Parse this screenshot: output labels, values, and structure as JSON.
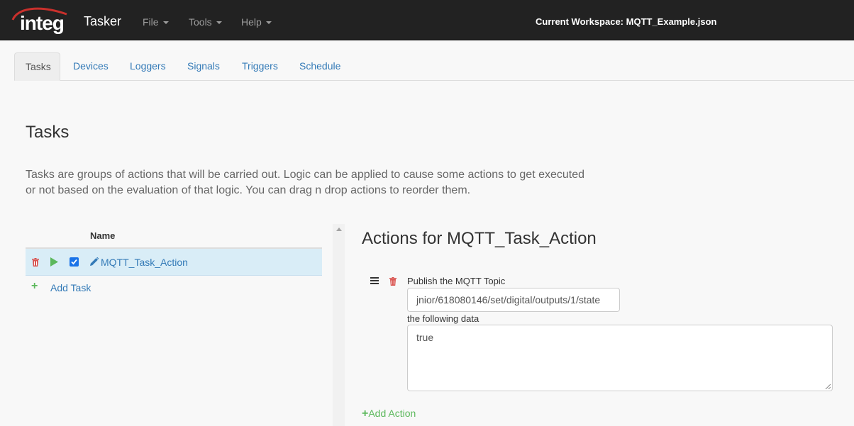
{
  "navbar": {
    "logo_text": "integ",
    "brand": "Tasker",
    "menus": [
      {
        "label": "File"
      },
      {
        "label": "Tools"
      },
      {
        "label": "Help"
      }
    ],
    "workspace": "Current Workspace: MQTT_Example.json",
    "colors": {
      "background": "#222222",
      "logo_red": "#c9302c"
    }
  },
  "tabs": [
    {
      "label": "Tasks",
      "active": true
    },
    {
      "label": "Devices"
    },
    {
      "label": "Loggers"
    },
    {
      "label": "Signals"
    },
    {
      "label": "Triggers"
    },
    {
      "label": "Schedule"
    }
  ],
  "page": {
    "title": "Tasks",
    "description": "Tasks are groups of actions that will be carried out. Logic can be applied to cause some actions to get executed or not based on the evaluation of that logic. You can drag n drop actions to reorder them."
  },
  "tasks": {
    "column_header": "Name",
    "rows": [
      {
        "name": "MQTT_Task_Action",
        "selected": true,
        "enabled": true
      }
    ],
    "add_label": "Add Task",
    "icons": [
      "trash-icon",
      "play-icon",
      "checkbox",
      "pencil-icon"
    ]
  },
  "actions": {
    "title": "Actions for MQTT_Task_Action",
    "items": [
      {
        "label": "Publish the MQTT Topic",
        "topic_value": "jnior/618080146/set/digital/outputs/1/state",
        "data_label": "the following data",
        "data_value": "true"
      }
    ],
    "add_label": "Add Action"
  },
  "colors": {
    "link": "#337ab7",
    "selected_row": "#d9edf7",
    "danger": "#d9534f",
    "success": "#5cb85c"
  }
}
